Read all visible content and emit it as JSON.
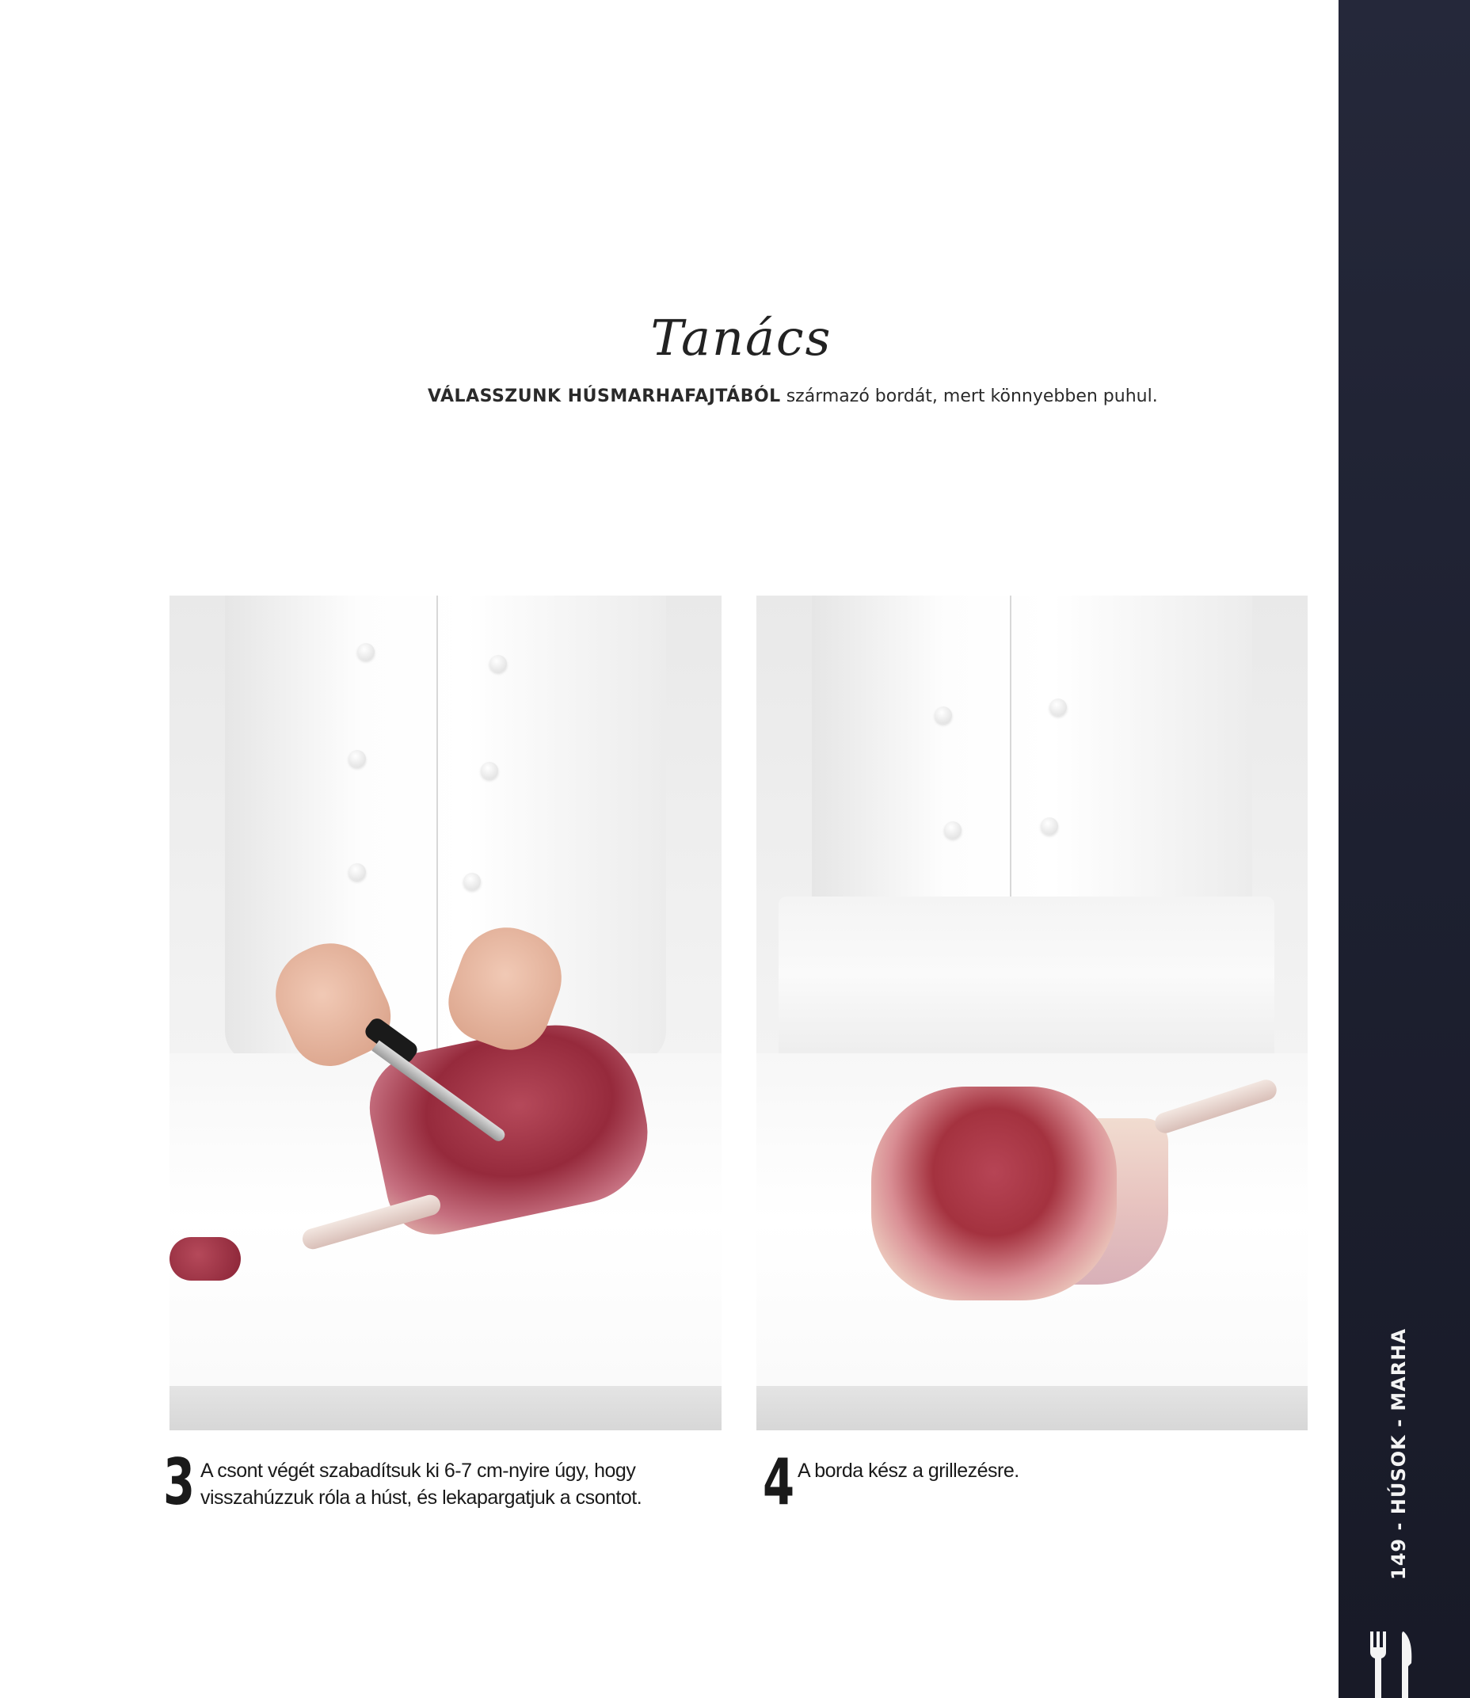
{
  "tip": {
    "heading": "Tanács",
    "lead": "VÁLASSZUNK HÚSMARHAFAJTÁBÓL",
    "text": "származó bordát, mert könnyebben puhul."
  },
  "steps": [
    {
      "number": "3",
      "text": "A csont végét szabadítsuk ki 6-7 cm-nyire úgy, hogy visszahúzzuk róla a húst, és lekapargatjuk a csontot."
    },
    {
      "number": "4",
      "text": "A borda kész a grillezésre."
    }
  ],
  "side": {
    "label": "149 - HÚSOK - MARHA",
    "icon": "cutlery-icon"
  }
}
